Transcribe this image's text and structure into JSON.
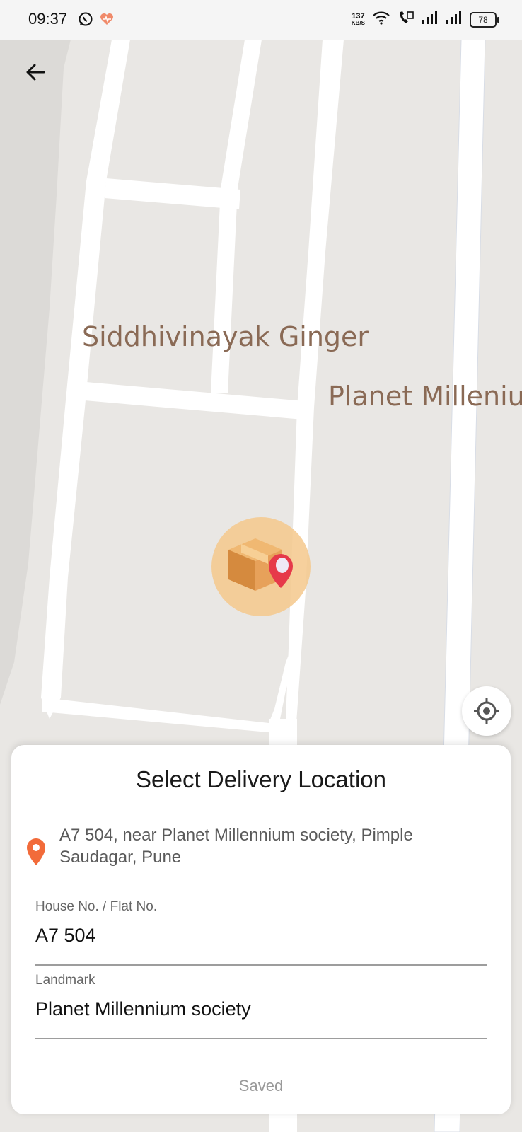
{
  "status_bar": {
    "time": "09:37",
    "speed_value": "137",
    "speed_unit": "KB/S",
    "battery": "78",
    "icons": [
      "whatsapp-icon",
      "heart-rate-icon",
      "wifi-icon",
      "hd-call-icon",
      "signal-icon",
      "signal-icon"
    ]
  },
  "map": {
    "labels": [
      "Siddhivinayak Ginger",
      "Planet Milleniu"
    ],
    "marker_icon": "package-pin-icon"
  },
  "toolbar": {
    "back_icon": "arrow-left-icon",
    "locate_icon": "crosshair-icon"
  },
  "sheet": {
    "title": "Select Delivery Location",
    "address": "A7 504, near Planet Millennium society, Pimple Saudagar, Pune",
    "address_icon": "location-pin-icon",
    "house_label": "House No. / Flat No.",
    "house_value": "A7 504",
    "landmark_label": "Landmark",
    "landmark_value": "Planet Millennium society",
    "save_label": "Saved"
  },
  "colors": {
    "map_background": "#e9e7e4",
    "road": "#ffffff",
    "label": "#8a6a55",
    "pin_accent": "#f26b3a",
    "marker_halo": "#f5c88c"
  }
}
